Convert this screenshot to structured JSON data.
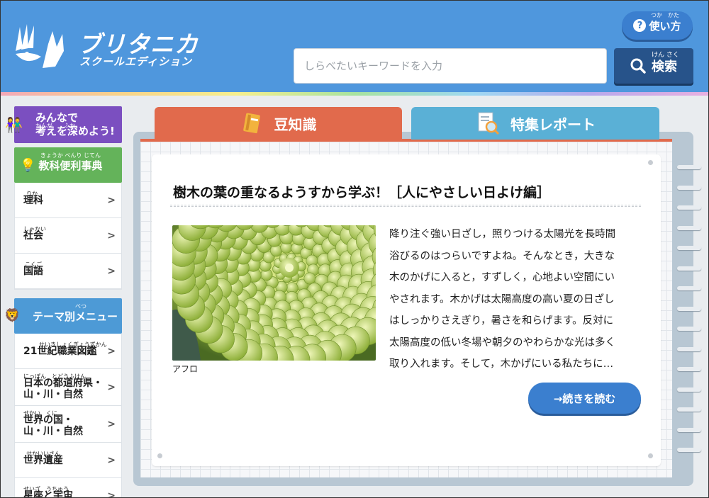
{
  "header": {
    "logo_title": "ブリタニカ",
    "logo_subtitle": "スクールエディション",
    "help_button": {
      "label": "使い方",
      "ruby": "つか　かた",
      "icon": "question-circle-icon"
    },
    "search": {
      "placeholder": "しらべたいキーワードを入力",
      "button_label": "検索",
      "button_ruby": "けん さく",
      "icon": "search-icon"
    }
  },
  "sidebar": {
    "minna": {
      "line1": "みんなで",
      "line2": "考えを深めよう!",
      "ruby": "かんが　　ふか"
    },
    "dictionary_head": {
      "label": "教科便利事典",
      "ruby": "きょうか べんり じてん"
    },
    "subjects": [
      {
        "label": "理科",
        "ruby": "りか"
      },
      {
        "label": "社会",
        "ruby": "しゃかい"
      },
      {
        "label": "国語",
        "ruby": "こくご"
      }
    ],
    "theme_head": {
      "label": "テーマ別メニュー",
      "ruby": "べつ"
    },
    "themes": [
      {
        "line1": "21世紀職業図鑑",
        "line2": "",
        "ruby": "せいきしょくぎょうずかん"
      },
      {
        "line1": "日本の都道府県・",
        "line2": "山・川・自然",
        "ruby": "にっぽん　とどうふけん"
      },
      {
        "line1": "世界の国・",
        "line2": "山・川・自然",
        "ruby": "せかい　くに"
      },
      {
        "line1": "世界遺産",
        "line2": "",
        "ruby": "せかいいさん"
      },
      {
        "line1": "星座と宇宙",
        "line2": "",
        "ruby": "せいざ　うちゅう"
      }
    ]
  },
  "tabs": [
    {
      "label": "豆知識",
      "icon": "book-icon",
      "color": "#e16a4c"
    },
    {
      "label": "特集レポート",
      "icon": "report-magnifier-icon",
      "color": "#5ab0d6"
    }
  ],
  "article": {
    "title": "樹木の葉の重なるようすから学ぶ！［人にやさしい日よけ編］",
    "image_caption": "アフロ",
    "body_lines": [
      "降り注ぐ強い日ざし，照りつける太陽光を長時間",
      "浴びるのはつらいですよね。そんなとき，大きな",
      "木のかげに入ると，すずしく，心地よい空間にい",
      "やされます。木かげは太陽高度の高い夏の日ざし",
      "はしっかりさえぎり，暑さを和らげます。反対に",
      "太陽高度の低い冬場や朝夕のやわらかな光は多く",
      "取り入れます。そして，木かげにいる私たちに…"
    ],
    "read_more": "→続きを読む"
  },
  "colors": {
    "header_bg": "#4f97dd",
    "accent_orange": "#e16a4c",
    "accent_blue": "#5ab0d6",
    "purple": "#7b4fc0",
    "green": "#64b35a"
  }
}
